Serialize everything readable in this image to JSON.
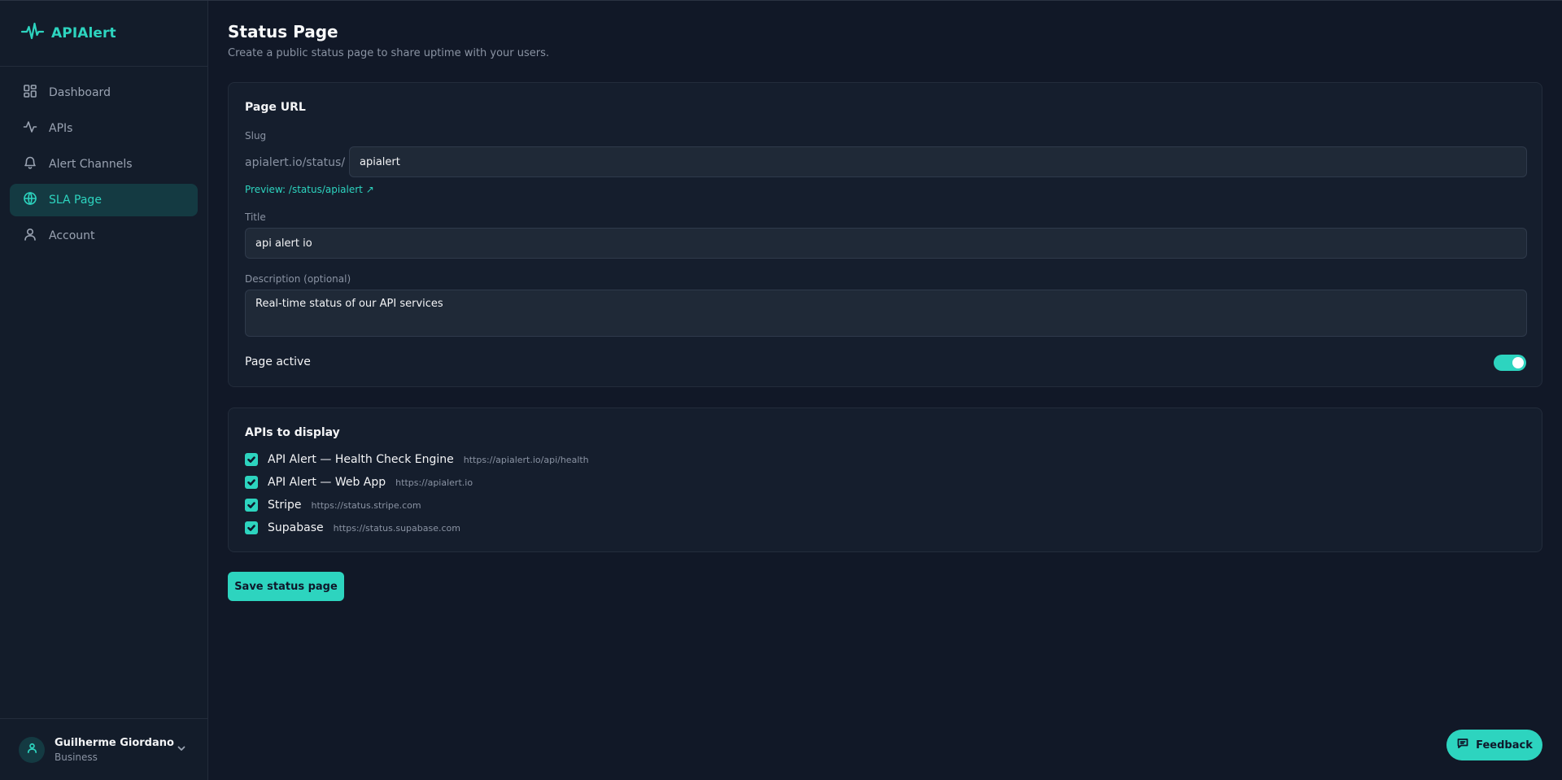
{
  "app": {
    "name": "APIAlert",
    "accent": "#2dd4bf",
    "background": "#111827"
  },
  "sidebar": {
    "items": [
      {
        "label": "Dashboard",
        "icon": "dashboard-grid-icon",
        "active": false
      },
      {
        "label": "APIs",
        "icon": "activity-icon",
        "active": false
      },
      {
        "label": "Alert Channels",
        "icon": "bell-icon",
        "active": false
      },
      {
        "label": "SLA Page",
        "icon": "globe-icon",
        "active": true
      },
      {
        "label": "Account",
        "icon": "user-icon",
        "active": false
      }
    ],
    "user": {
      "name": "Guilherme Giordano",
      "plan": "Business"
    }
  },
  "page": {
    "title": "Status Page",
    "subtitle": "Create a public status page to share uptime with your users."
  },
  "page_url": {
    "section_title": "Page URL",
    "slug_label": "Slug",
    "slug_prefix": "apialert.io/status/",
    "slug_value": "apialert",
    "preview": "Preview: /status/apialert ↗",
    "title_label": "Title",
    "title_value": "api alert io",
    "description_label": "Description (optional)",
    "description_value": "Real-time status of our API services",
    "active_label": "Page active",
    "active": true
  },
  "apis": {
    "section_title": "APIs to display",
    "items": [
      {
        "name": "API Alert — Health Check Engine",
        "url": "https://apialert.io/api/health",
        "checked": true
      },
      {
        "name": "API Alert — Web App",
        "url": "https://apialert.io",
        "checked": true
      },
      {
        "name": "Stripe",
        "url": "https://status.stripe.com",
        "checked": true
      },
      {
        "name": "Supabase",
        "url": "https://status.supabase.com",
        "checked": true
      }
    ]
  },
  "actions": {
    "save_label": "Save status page",
    "feedback_label": "Feedback"
  }
}
